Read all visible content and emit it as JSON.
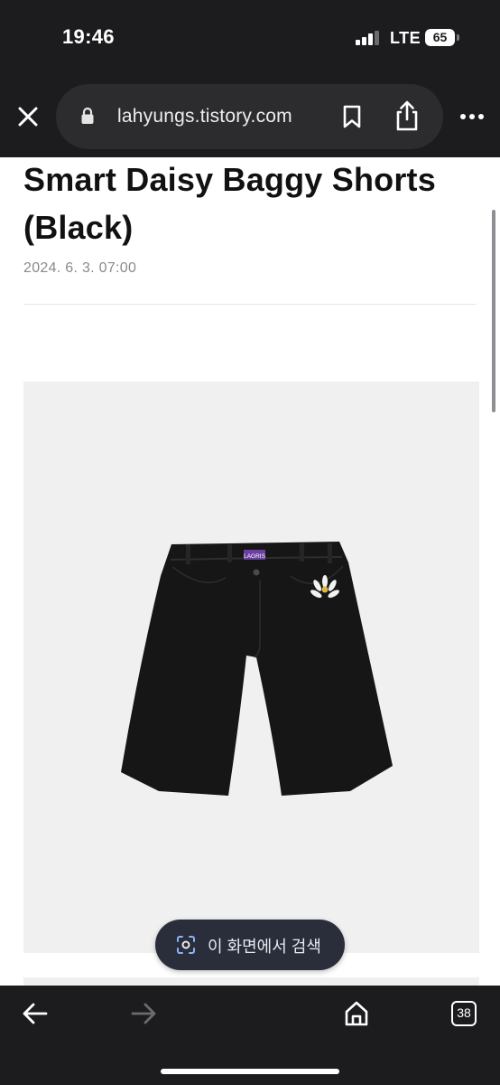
{
  "status_bar": {
    "time": "19:46",
    "network": "LTE",
    "battery": "65"
  },
  "browser": {
    "url": "lahyungs.tistory.com",
    "icons": [
      "close-icon",
      "lock-icon",
      "bookmark-icon",
      "share-icon",
      "more-icon"
    ]
  },
  "post": {
    "title": "Smart Daisy Baggy Shorts (Black)",
    "date": "2024. 6. 3. 07:00"
  },
  "product_image": {
    "label_text": "LAGRIS",
    "colors": {
      "background": "#f0f0f0",
      "garment": "#161616",
      "tag": "#6b3fa0"
    }
  },
  "lens": {
    "label": "이 화면에서 검색",
    "icon": "lens-icon"
  },
  "toolbar": {
    "tab_count": "38",
    "icons": [
      "back-arrow-icon",
      "forward-arrow-icon",
      "home-icon",
      "tabs-icon"
    ]
  }
}
